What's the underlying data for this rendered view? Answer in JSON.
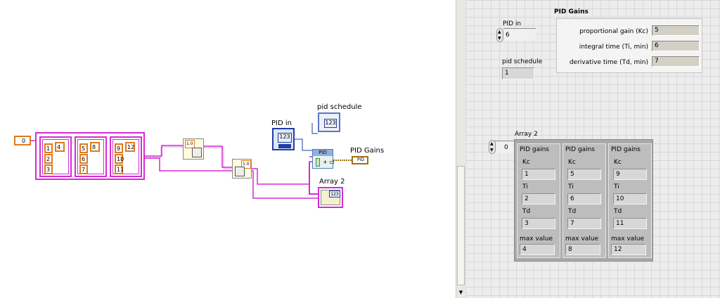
{
  "diagram": {
    "index_const": "0",
    "cluster1": [
      "1",
      "2",
      "3"
    ],
    "cluster1_side": "4",
    "cluster2": [
      "5",
      "6",
      "7"
    ],
    "cluster2_side": "8",
    "cluster3": [
      "9",
      "10",
      "11"
    ],
    "cluster3_side": "12",
    "bundle1_tag": "1.0",
    "bundle2_tag": "1.0",
    "pid_in_label": "PID in",
    "pid_in_value": "123",
    "pid_schedule_label": "pid schedule",
    "pid_schedule_value": "123",
    "pid_node_label": "PID",
    "pid_gains_label": "PID Gains",
    "pid_gains_term": "PID",
    "array2_label": "Array 2",
    "array2_value": "123"
  },
  "panel": {
    "pid_in": {
      "label": "PID in",
      "value": "6"
    },
    "pid_schedule": {
      "label": "pid schedule",
      "value": "1"
    },
    "pid_gains": {
      "title": "PID Gains",
      "rows": [
        {
          "label": "proportional gain (Kc)",
          "value": "5"
        },
        {
          "label": "integral time (Ti, min)",
          "value": "6"
        },
        {
          "label": "derivative time (Td, min)",
          "value": "7"
        }
      ]
    },
    "array2": {
      "label": "Array 2",
      "index": "0",
      "elements": [
        {
          "title": "PID gains",
          "kc_label": "Kc",
          "kc": "1",
          "ti_label": "Ti",
          "ti": "2",
          "td_label": "Td",
          "td": "3",
          "max_label": "max value",
          "max": "4"
        },
        {
          "title": "PID gains",
          "kc_label": "Kc",
          "kc": "5",
          "ti_label": "Ti",
          "ti": "6",
          "td_label": "Td",
          "td": "7",
          "max_label": "max value",
          "max": "8"
        },
        {
          "title": "PID gains",
          "kc_label": "Kc",
          "kc": "9",
          "ti_label": "Ti",
          "ti": "10",
          "td_label": "Td",
          "td": "11",
          "max_label": "max value",
          "max": "12"
        }
      ]
    }
  },
  "colors": {
    "cluster_wire": "#d42bd4",
    "numeric_wire": "#e07a1a",
    "control_blue": "#1f3da8"
  }
}
